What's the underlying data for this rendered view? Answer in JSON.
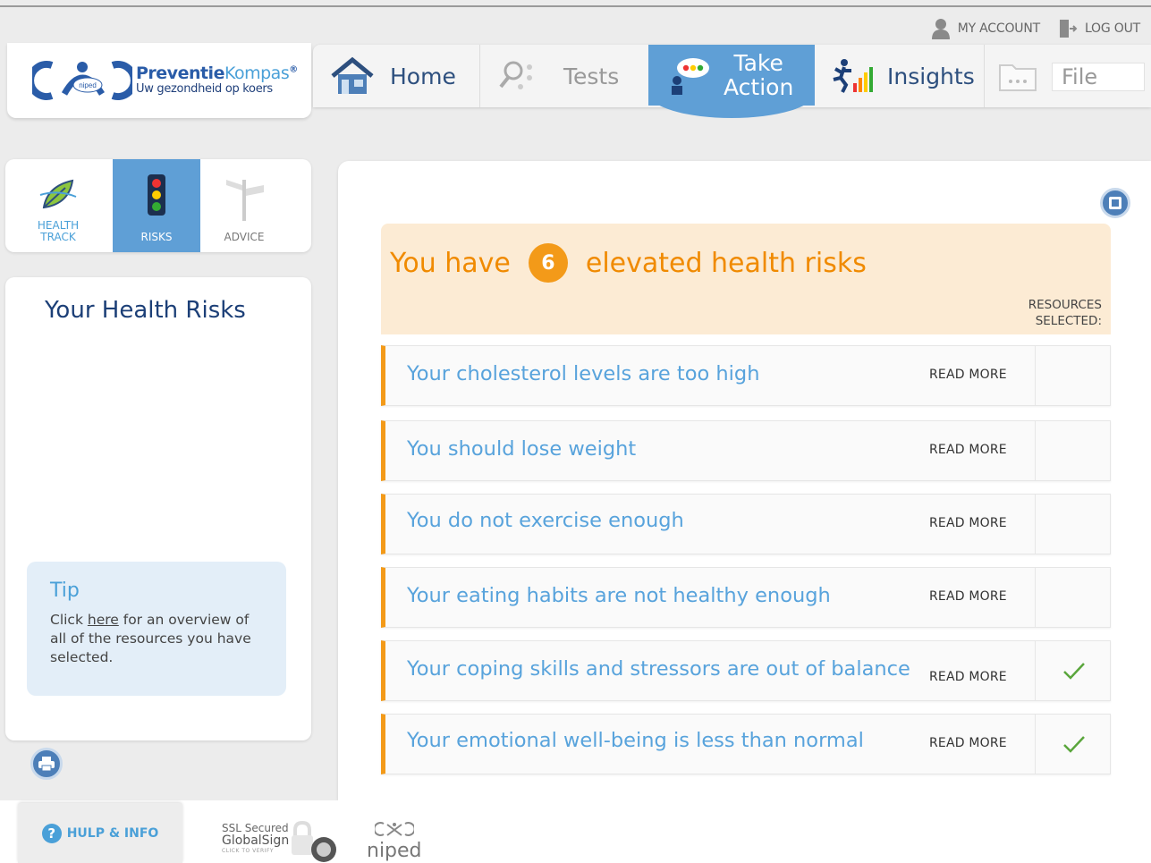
{
  "account": {
    "my_account": "MY ACCOUNT",
    "log_out": "LOG OUT"
  },
  "logo": {
    "brand_main": "Preventie",
    "brand_accent": "Kompas",
    "registered": "®",
    "tagline": "Uw gezondheid op koers",
    "mark_text": "niped"
  },
  "nav": {
    "home": "Home",
    "tests": "Tests",
    "take_action_1": "Take",
    "take_action_2": "Action",
    "insights": "Insights",
    "file": "File"
  },
  "subtabs": {
    "health_track_1": "HEALTH",
    "health_track_2": "TRACK",
    "risks": "RISKS",
    "advice": "ADVICE"
  },
  "left": {
    "title": "Your Health Risks",
    "tip_title": "Tip",
    "tip_pre": "Click ",
    "tip_link": "here",
    "tip_post": " for an overview of all of the resources you have selected."
  },
  "banner": {
    "prefix": "You have",
    "count": "6",
    "suffix": "elevated health risks",
    "resources_1": "RESOURCES",
    "resources_2": "SELECTED:"
  },
  "risks": [
    {
      "text": "Your cholesterol levels are too high",
      "action": "READ MORE",
      "selected": false
    },
    {
      "text": "You should lose weight",
      "action": "READ MORE",
      "selected": false
    },
    {
      "text": "You do not exercise enough",
      "action": "READ MORE",
      "selected": false
    },
    {
      "text": "Your eating habits are not healthy enough",
      "action": "READ MORE",
      "selected": false
    },
    {
      "text": "Your coping skills and stressors are out of balance",
      "action": "READ MORE",
      "selected": true
    },
    {
      "text": "Your emotional well-being is less than normal",
      "action": "READ MORE",
      "selected": true
    }
  ],
  "footer": {
    "help": "HULP & INFO",
    "help_icon": "?",
    "ssl_1": "SSL Secured",
    "ssl_2": "GlobalSign",
    "ssl_3": "CLICK TO VERIFY",
    "niped": "niped"
  },
  "colors": {
    "accent_blue": "#5f9fd6",
    "risk_orange": "#f39a19",
    "link_blue": "#58a3dc",
    "check_green": "#5aa63c"
  },
  "icons": {
    "user": "user-icon",
    "logout": "logout-icon",
    "home": "home-icon",
    "tests": "tests-icon",
    "take_action": "chat-person-icon",
    "insights": "runner-chart-icon",
    "file": "folder-icon",
    "health_track": "leaf-icon",
    "risks": "traffic-light-icon",
    "advice": "signpost-icon",
    "print": "print-icon",
    "expand": "expand-icon",
    "check": "check-icon",
    "help": "help-icon",
    "lock": "lock-icon"
  }
}
